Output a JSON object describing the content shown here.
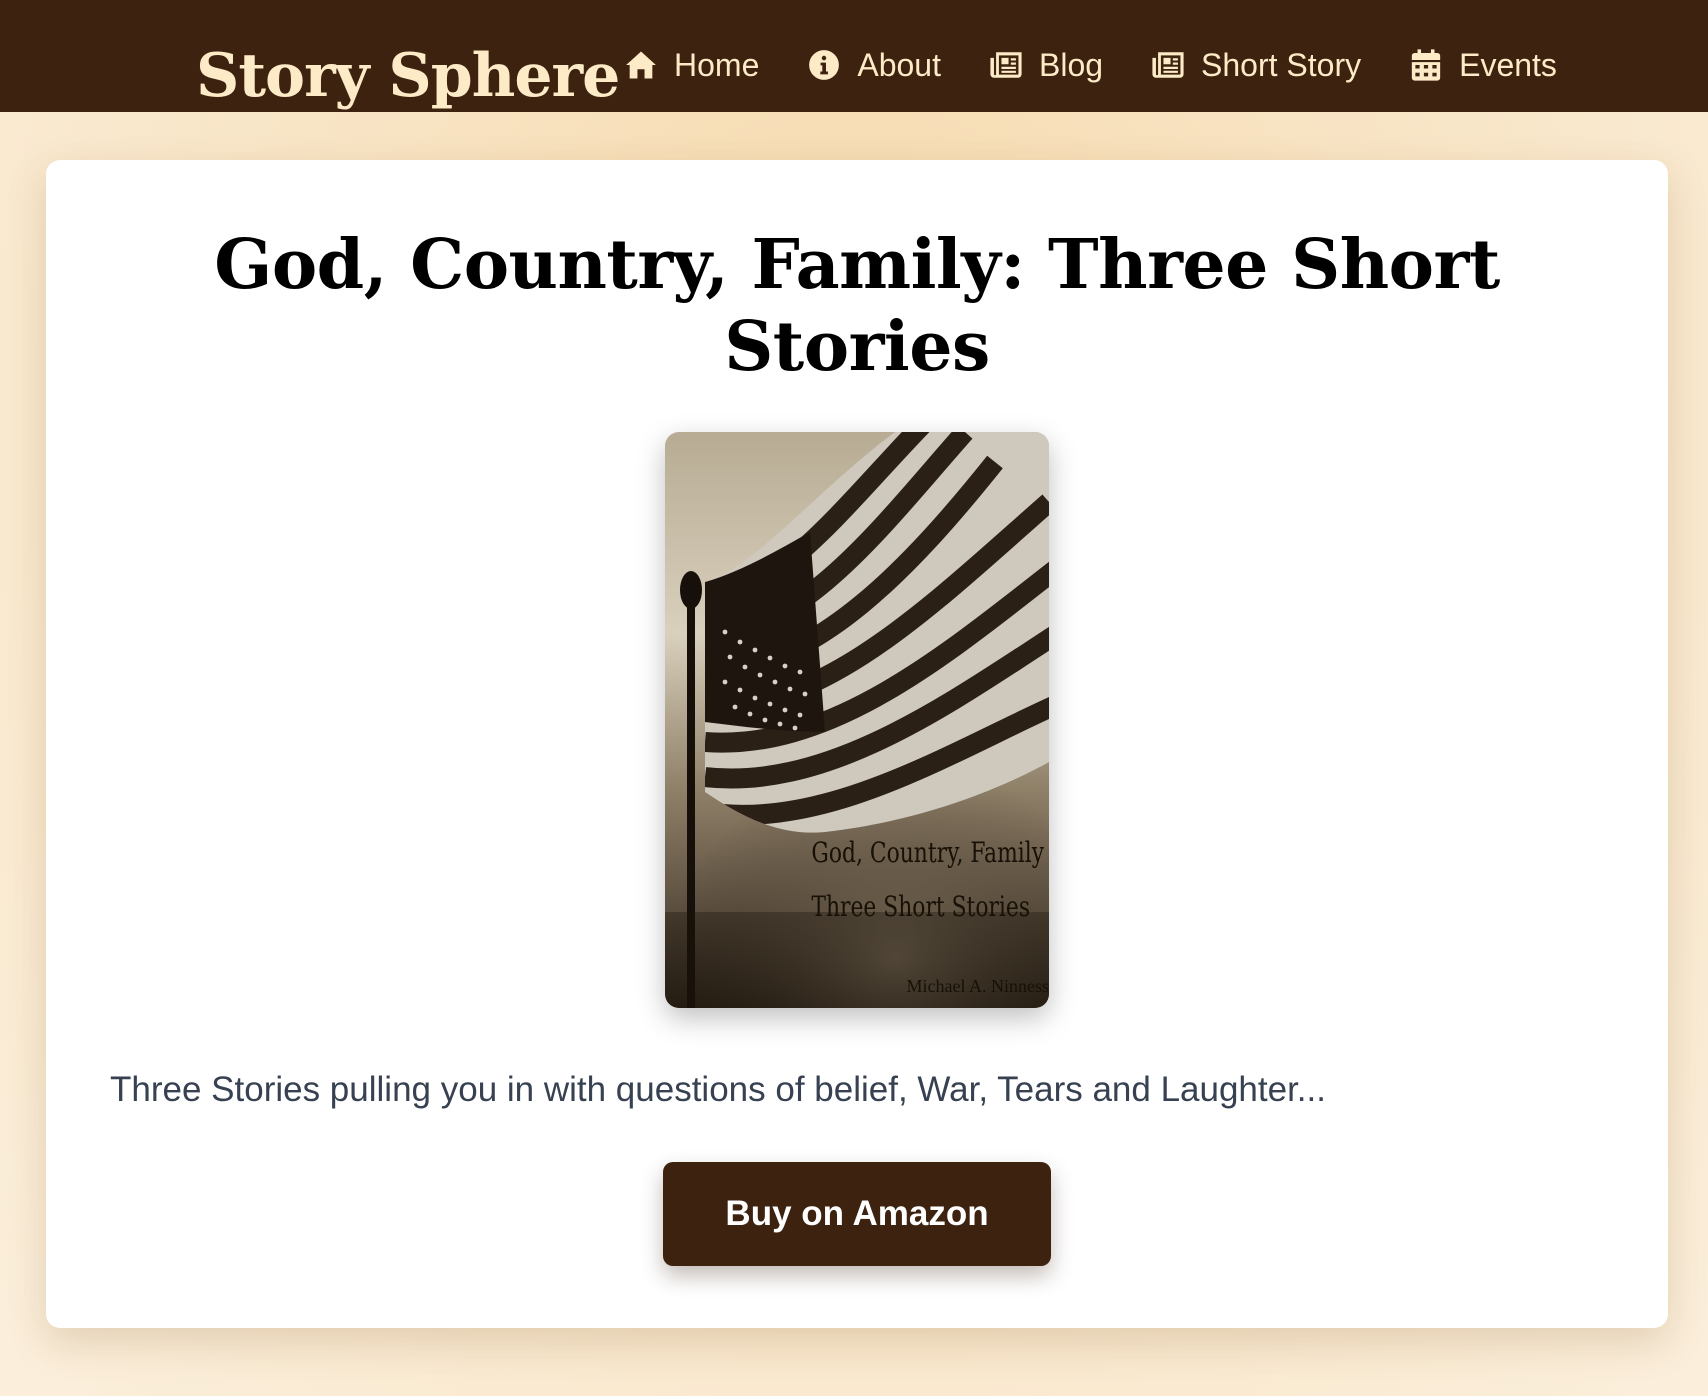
{
  "site": {
    "brand": "Story Sphere"
  },
  "nav": {
    "items": [
      {
        "label": "Home",
        "icon": "home-icon"
      },
      {
        "label": "About",
        "icon": "info-circle-icon"
      },
      {
        "label": "Blog",
        "icon": "newspaper-icon"
      },
      {
        "label": "Short Story",
        "icon": "newspaper-icon"
      },
      {
        "label": "Events",
        "icon": "calendar-icon"
      }
    ]
  },
  "book": {
    "title": "God, Country, Family: Three Short Stories",
    "cover": {
      "line1": "God, Country, Family",
      "line2": "Three Short Stories",
      "author": "Michael A. Ninness"
    },
    "description": "Three Stories pulling you in with questions of belief, War, Tears and Laughter...",
    "buy_label": "Buy on Amazon"
  },
  "colors": {
    "header_bg": "#3d2210",
    "brand_text": "#fcebc6",
    "button_bg": "#3d2210",
    "description_text": "#374151",
    "page_bg": "#f8e4c4"
  }
}
